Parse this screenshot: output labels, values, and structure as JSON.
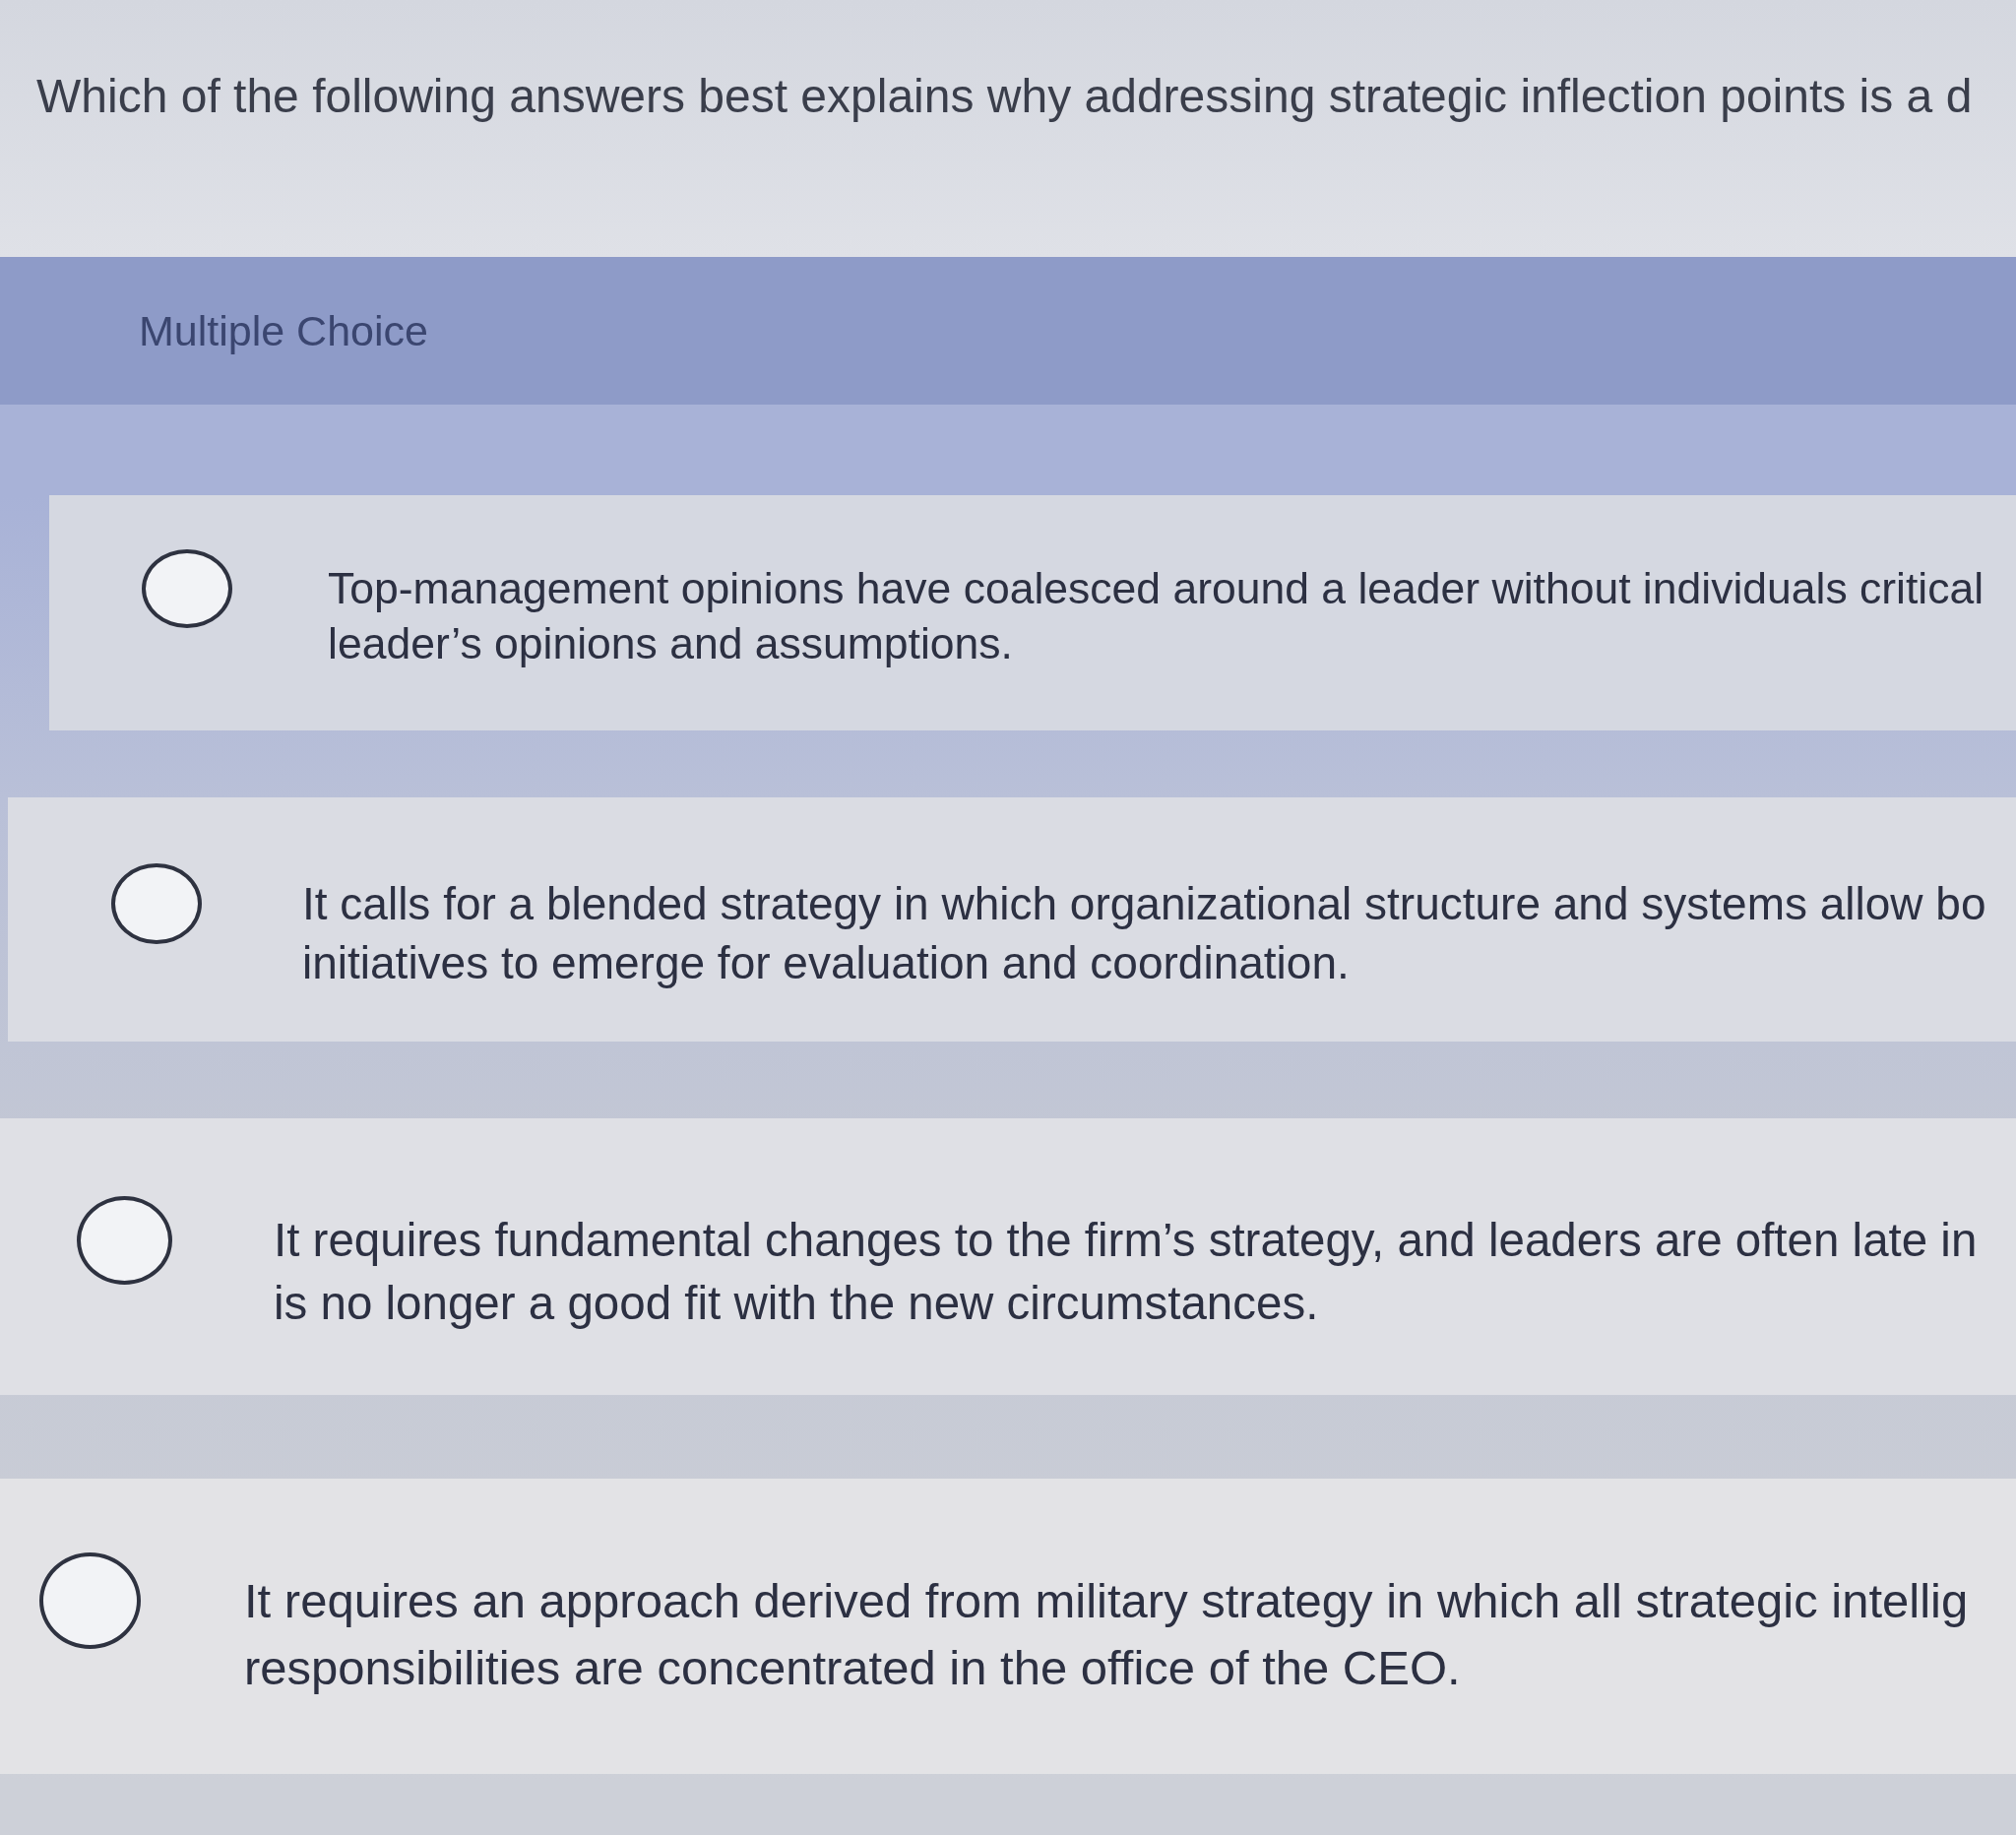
{
  "question": {
    "text": "Which of the following answers best explains why addressing strategic inflection points is a d"
  },
  "section": {
    "label": "Multiple Choice"
  },
  "options": [
    {
      "lines": [
        "Top-management opinions have coalesced around a leader without individuals critical",
        "leader’s opinions and assumptions."
      ],
      "selected": false
    },
    {
      "lines": [
        "It calls for a blended strategy in which organizational structure and systems allow bo",
        "initiatives to emerge for evaluation and coordination."
      ],
      "selected": false
    },
    {
      "lines": [
        "It requires fundamental changes to the firm’s strategy, and leaders are often late in",
        "is no longer a good fit with the new circumstances."
      ],
      "selected": false
    },
    {
      "lines": [
        "It requires an approach derived from military strategy in which all strategic intellig",
        "responsibilities are concentrated in the office of the CEO."
      ],
      "selected": false
    }
  ]
}
